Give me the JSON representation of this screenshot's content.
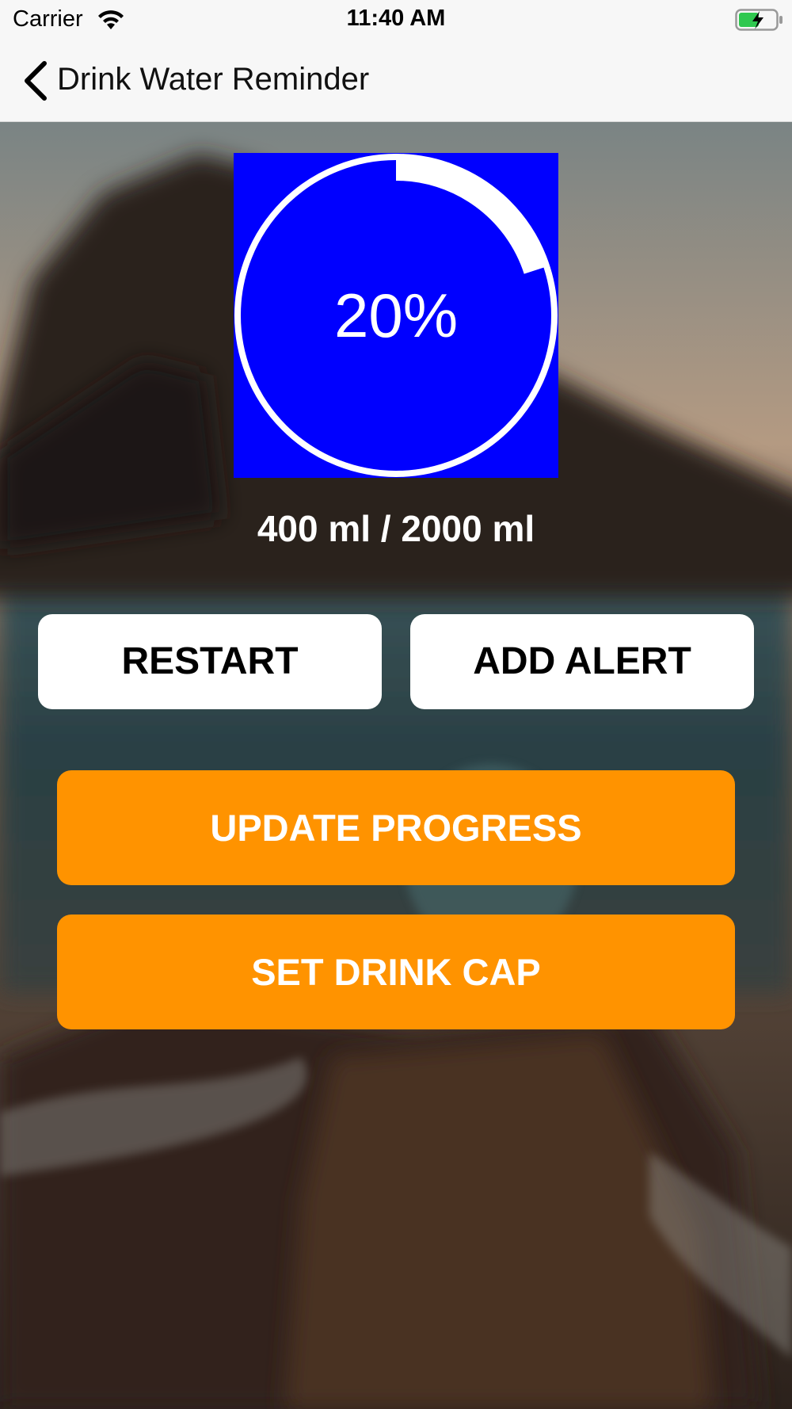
{
  "status_bar": {
    "carrier": "Carrier",
    "time": "11:40 AM",
    "wifi_icon": "wifi-icon",
    "battery_icon": "battery-charging-icon"
  },
  "nav": {
    "back_icon": "chevron-left-icon",
    "title": "Drink Water Reminder"
  },
  "progress": {
    "percent_label": "20%",
    "fraction": 0.2,
    "ring_color": "#ffffff",
    "box_color": "#0000ff"
  },
  "volume": {
    "text": "400 ml / 2000 ml"
  },
  "buttons": {
    "restart": "RESTART",
    "add_alert": "ADD ALERT",
    "update_progress": "UPDATE PROGRESS",
    "set_drink_cap": "SET DRINK CAP"
  },
  "colors": {
    "accent_orange": "#ff9300",
    "button_white": "#ffffff",
    "bar_background": "#f7f7f7"
  }
}
